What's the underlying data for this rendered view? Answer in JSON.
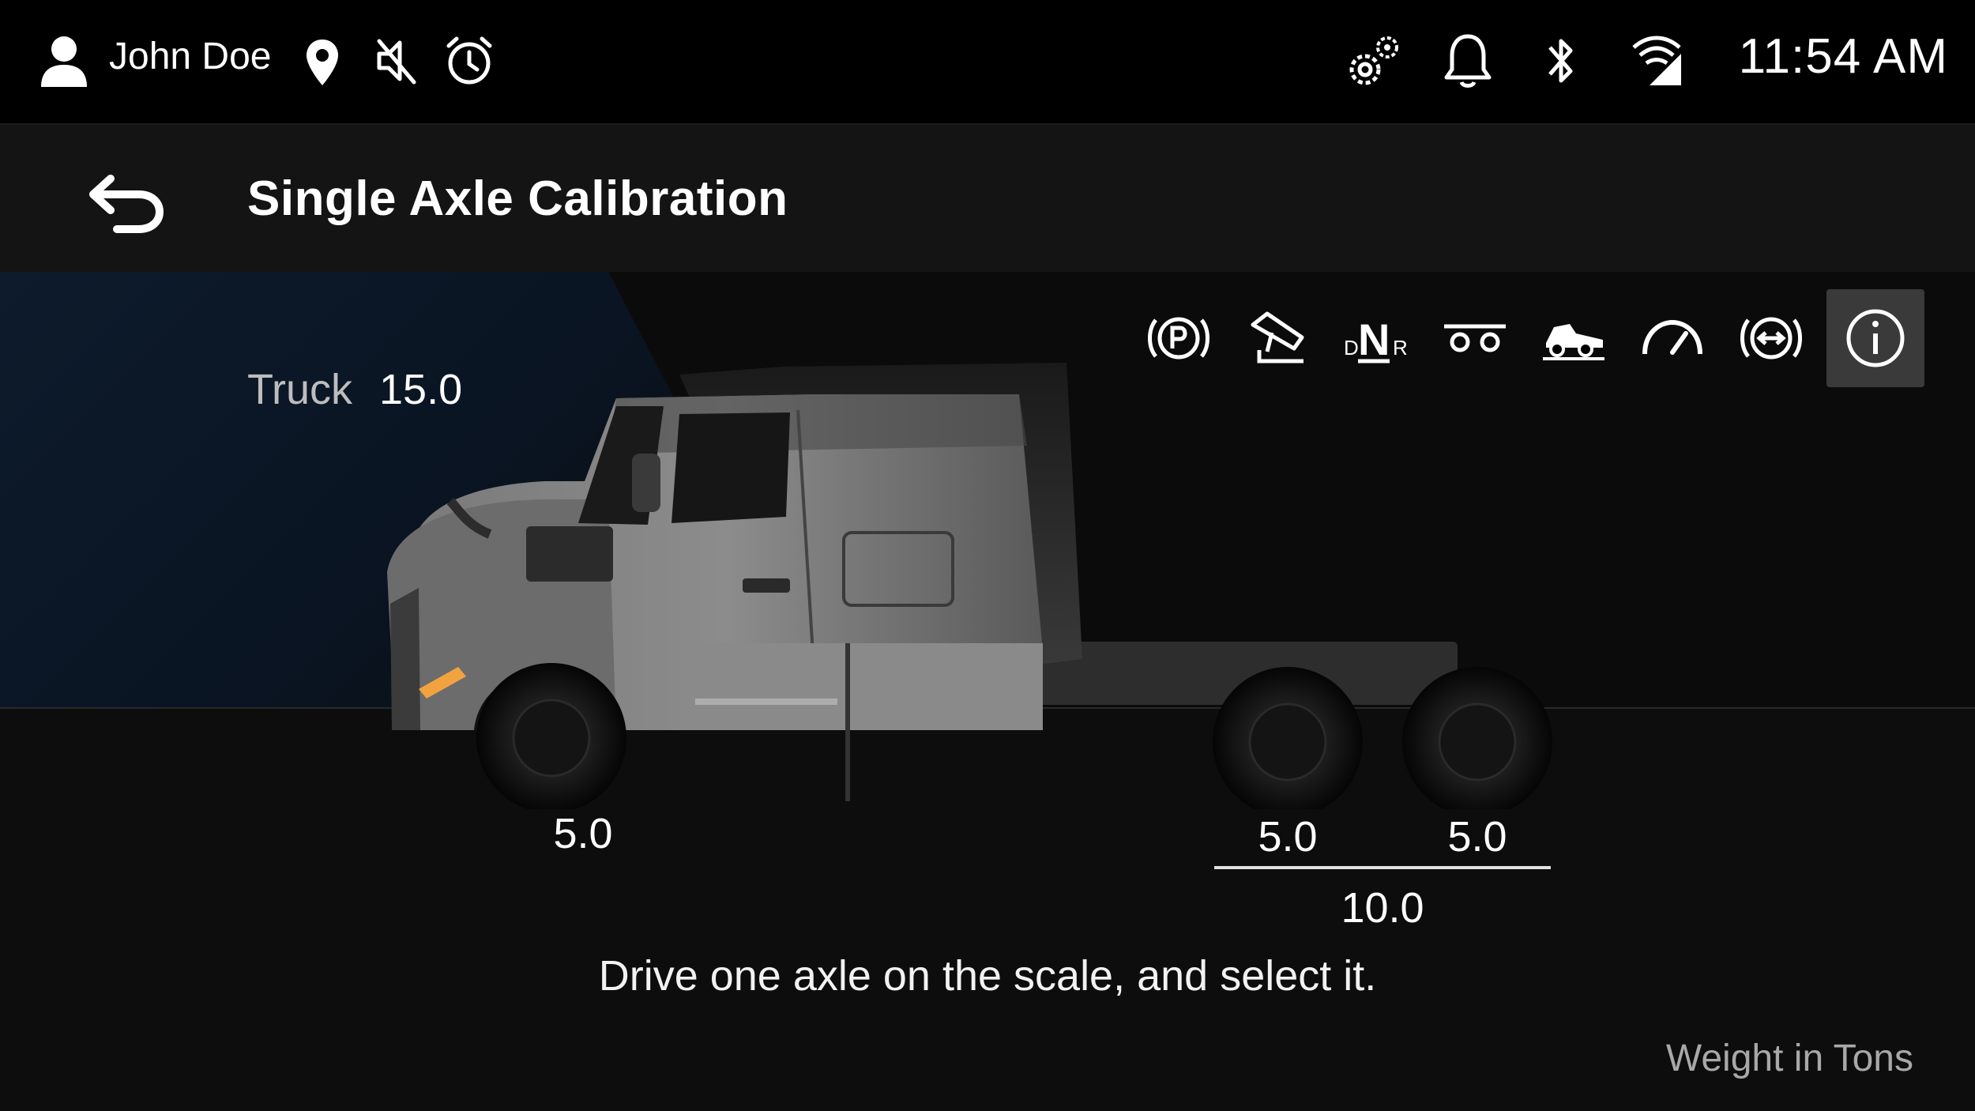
{
  "status_bar": {
    "user_name": "John Doe",
    "time": "11:54 AM",
    "icons_left": [
      "user-icon",
      "location-pin-icon",
      "mute-icon",
      "alarm-clock-icon"
    ],
    "icons_right": [
      "settings-gears-icon",
      "notification-bell-icon",
      "bluetooth-icon",
      "cellular-wifi-icon"
    ]
  },
  "header": {
    "title": "Single Axle Calibration",
    "back_icon": "back-arrow-icon"
  },
  "toolbar": {
    "icons": [
      "parking-brake-icon",
      "pedal-icon",
      "gear-selector-dnr-icon",
      "axle-config-icon",
      "off-road-truck-icon",
      "speedometer-icon",
      "brake-system-icon",
      "info-icon"
    ],
    "gear_text": {
      "d": "D",
      "n": "N",
      "r": "R"
    },
    "active": "info-icon"
  },
  "truck": {
    "label": "Truck",
    "total": "15.0"
  },
  "axles": {
    "front": "5.0",
    "rear_1": "5.0",
    "rear_2": "5.0",
    "rear_group_total": "10.0"
  },
  "instruction": "Drive one axle on the scale, and select it.",
  "units_label": "Weight in Tons",
  "colors": {
    "background": "#0b0b0b",
    "status_bar": "#000000",
    "title_bar": "#141414",
    "accent_blue_glow": "#0d1b2c",
    "active_tool": "#3a3a3a"
  }
}
